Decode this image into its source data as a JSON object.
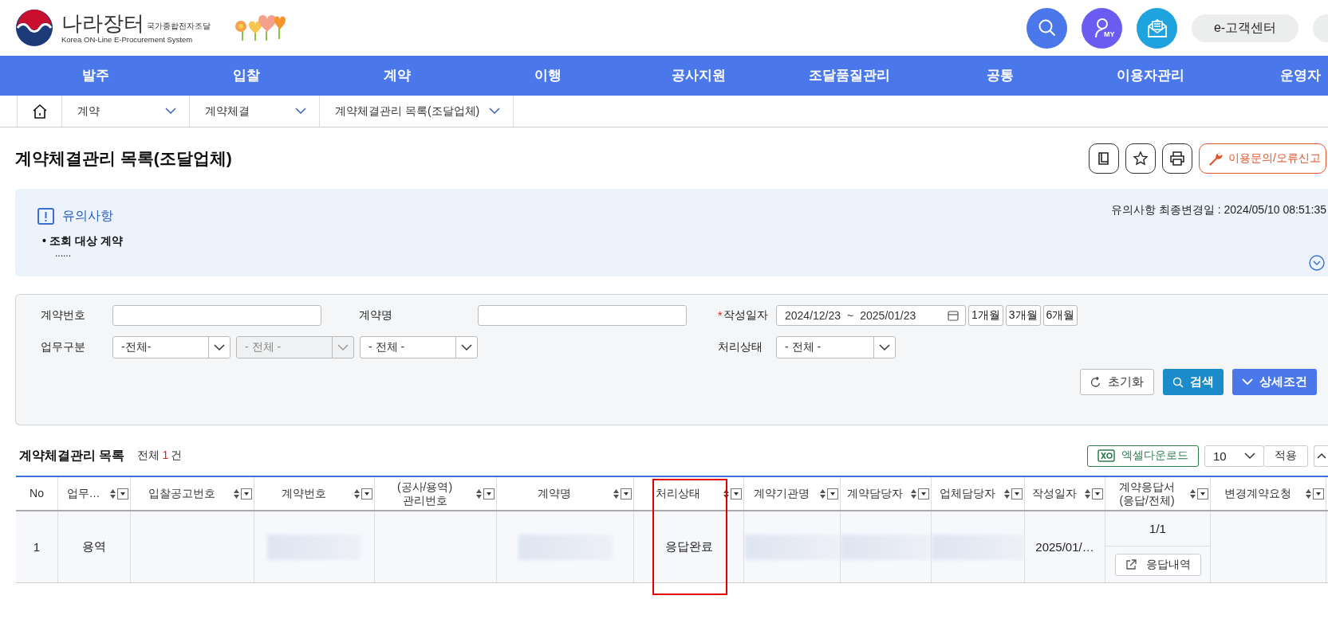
{
  "header": {
    "logo": {
      "name": "나라장터",
      "subtitle": "국가종합전자조달",
      "tagline": "Korea ON-Line E-Procurement System"
    },
    "buttons": [
      {
        "kind": "search"
      },
      {
        "kind": "my",
        "label": "MY"
      },
      {
        "kind": "mail"
      },
      {
        "kind": "pill",
        "label": "e-고객센터"
      },
      {
        "kind": "pill_cut"
      }
    ]
  },
  "nav": [
    "발주",
    "입찰",
    "계약",
    "이행",
    "공사지원",
    "조달품질관리",
    "공통",
    "이용자관리",
    "운영자"
  ],
  "breadcrumb": [
    "계약",
    "계약체결",
    "계약체결관리 목록(조달업체)"
  ],
  "page": {
    "title": "계약체결관리 목록(조달업체)",
    "tools": [
      {
        "kind": "book"
      },
      {
        "kind": "star"
      },
      {
        "kind": "print"
      },
      {
        "kind": "report",
        "label": "이용문의/오류신고"
      }
    ]
  },
  "notice": {
    "title": "유의사항",
    "updated": "유의사항 최종변경일 : 2024/05/10 08:51:35",
    "items": [
      "• 조회 대상 계약"
    ],
    "more": "......",
    "expanded": false
  },
  "search": {
    "fields": [
      {
        "kind": "text",
        "label": "계약번호"
      },
      {
        "kind": "text",
        "label": "계약명"
      },
      {
        "kind": "date",
        "label": "작성일자",
        "required_mark": "*",
        "from": "2024/12/23",
        "separator": "~",
        "to": "2025/01/23",
        "presets": [
          "1개월",
          "3개월",
          "6개월"
        ]
      },
      {
        "kind": "select",
        "label": "업무구분",
        "selects": [
          {
            "value": "-전체-",
            "disabled": false
          },
          {
            "value": "- 전체 -",
            "disabled": true
          },
          {
            "value": "- 전체 -",
            "disabled": false
          }
        ]
      },
      {
        "kind": "select",
        "label": "처리상태",
        "selects": [
          {
            "value": "- 전체 -",
            "disabled": false
          }
        ]
      }
    ],
    "actions": [
      {
        "kind": "reset",
        "label": "초기화"
      },
      {
        "kind": "search",
        "label": "검색"
      },
      {
        "kind": "detail",
        "label": "상세조건"
      }
    ]
  },
  "list": {
    "title": "계약체결관리 목록",
    "total_prefix": "전체",
    "total_count": "1",
    "total_suffix": "건",
    "excel": "엑셀다운로드",
    "page_size": "10",
    "apply": "적용",
    "columns": [
      {
        "label": "No",
        "sortable": false,
        "highlighted": false
      },
      {
        "label": "업무…",
        "sortable": true,
        "highlighted": false
      },
      {
        "label": "입찰공고번호",
        "sortable": true,
        "highlighted": false
      },
      {
        "label": "계약번호",
        "sortable": true,
        "highlighted": false
      },
      {
        "label": "(공사/용역)\n관리번호",
        "sortable": true,
        "highlighted": false
      },
      {
        "label": "계약명",
        "sortable": true,
        "highlighted": false
      },
      {
        "label": "처리상태",
        "sortable": true,
        "highlighted": true
      },
      {
        "label": "계약기관명",
        "sortable": true,
        "highlighted": false
      },
      {
        "label": "계약담당자",
        "sortable": true,
        "highlighted": false
      },
      {
        "label": "업체담당자",
        "sortable": true,
        "highlighted": false
      },
      {
        "label": "작성일자",
        "sortable": true,
        "highlighted": false
      },
      {
        "label": "계약응답서\n(응답/전체)",
        "sortable": true,
        "highlighted": false
      },
      {
        "label": "변경계약요청",
        "sortable": true,
        "highlighted": false
      }
    ],
    "rows": [
      {
        "cells": [
          {
            "kind": "text",
            "text": "1"
          },
          {
            "kind": "text",
            "text": "용역"
          },
          {
            "kind": "blank"
          },
          {
            "kind": "blurred"
          },
          {
            "kind": "blank"
          },
          {
            "kind": "blurred"
          },
          {
            "kind": "text",
            "text": "응답완료"
          },
          {
            "kind": "blurred"
          },
          {
            "kind": "blurred"
          },
          {
            "kind": "blurred"
          },
          {
            "kind": "text",
            "text": "2025/01/…"
          },
          {
            "kind": "response",
            "text": "1/1",
            "button": "응답내역"
          },
          {
            "kind": "blank"
          }
        ]
      }
    ]
  }
}
